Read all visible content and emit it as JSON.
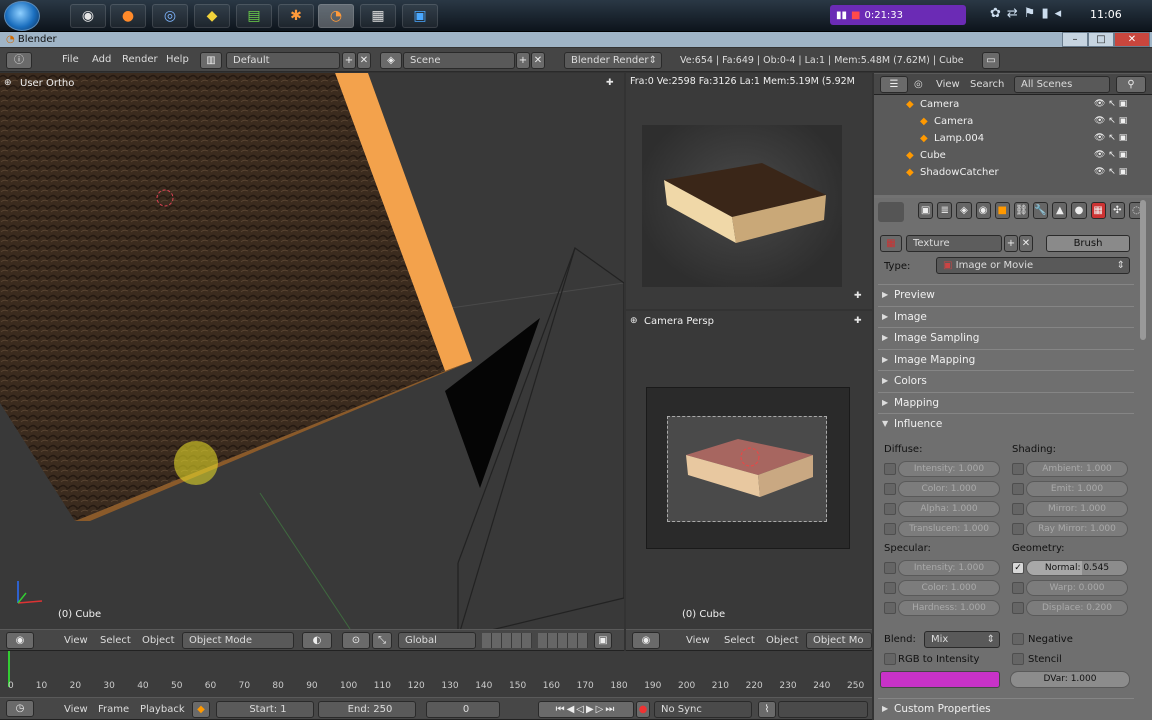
{
  "taskbar": {
    "recorder_time": "0:21:33",
    "clock": "11:06"
  },
  "window": {
    "title": "Blender"
  },
  "menubar": {
    "menus": [
      "File",
      "Add",
      "Render",
      "Help"
    ],
    "layout": "Default",
    "scene": "Scene",
    "engine": "Blender Render",
    "stats": "Ve:654 | Fa:649 | Ob:0-4 | La:1 | Mem:5.48M (7.62M) | Cube"
  },
  "viewport_main": {
    "label": "User Ortho",
    "object": "(0) Cube",
    "header": {
      "view": "View",
      "select": "Select",
      "object": "Object",
      "mode": "Object Mode",
      "orientation": "Global"
    }
  },
  "viewport_render": {
    "stats": "Fra:0  Ve:2598 Fa:3126 La:1 Mem:5.19M (5.92M"
  },
  "viewport_camera": {
    "label": "Camera Persp",
    "object": "(0) Cube",
    "header": {
      "view": "View",
      "select": "Select",
      "object": "Object",
      "mode": "Object Mo"
    }
  },
  "timeline": {
    "ticks": [
      "0",
      "10",
      "20",
      "30",
      "40",
      "50",
      "60",
      "70",
      "80",
      "90",
      "100",
      "110",
      "120",
      "130",
      "140",
      "150",
      "160",
      "170",
      "180",
      "190",
      "200",
      "210",
      "220",
      "230",
      "240",
      "250"
    ],
    "header": {
      "view": "View",
      "frame": "Frame",
      "playback": "Playback",
      "start": "Start: 1",
      "end": "End: 250",
      "current": "0",
      "sync": "No Sync"
    }
  },
  "outliner": {
    "view": "View",
    "search": "Search",
    "filter": "All Scenes",
    "items": [
      {
        "label": "Camera",
        "indent": 1
      },
      {
        "label": "Camera",
        "indent": 2
      },
      {
        "label": "Lamp.004",
        "indent": 2
      },
      {
        "label": "Cube",
        "indent": 1
      },
      {
        "label": "ShadowCatcher",
        "indent": 1
      }
    ]
  },
  "properties": {
    "texture_name": "Texture",
    "brush": "Brush",
    "type_label": "Type:",
    "type_value": "Image or Movie",
    "sections": [
      "Preview",
      "Image",
      "Image Sampling",
      "Image Mapping",
      "Colors",
      "Mapping",
      "Influence"
    ],
    "diffuse_label": "Diffuse:",
    "shading_label": "Shading:",
    "specular_label": "Specular:",
    "geometry_label": "Geometry:",
    "diffuse": [
      "Intensity: 1.000",
      "Color: 1.000",
      "Alpha: 1.000",
      "Translucen: 1.000"
    ],
    "shading": [
      "Ambient: 1.000",
      "Emit: 1.000",
      "Mirror: 1.000",
      "Ray Mirror: 1.000"
    ],
    "specular": [
      "Intensity: 1.000",
      "Color: 1.000",
      "Hardness: 1.000"
    ],
    "geometry": [
      "Normal: 0.545",
      "Warp: 0.000",
      "Displace: 0.200"
    ],
    "blend_label": "Blend:",
    "blend_value": "Mix",
    "negative": "Negative",
    "rgb_to_intensity": "RGB to Intensity",
    "stencil": "Stencil",
    "dvar": "DVar: 1.000",
    "custom_properties": "Custom Properties",
    "swatch_color": "#c832c8"
  }
}
